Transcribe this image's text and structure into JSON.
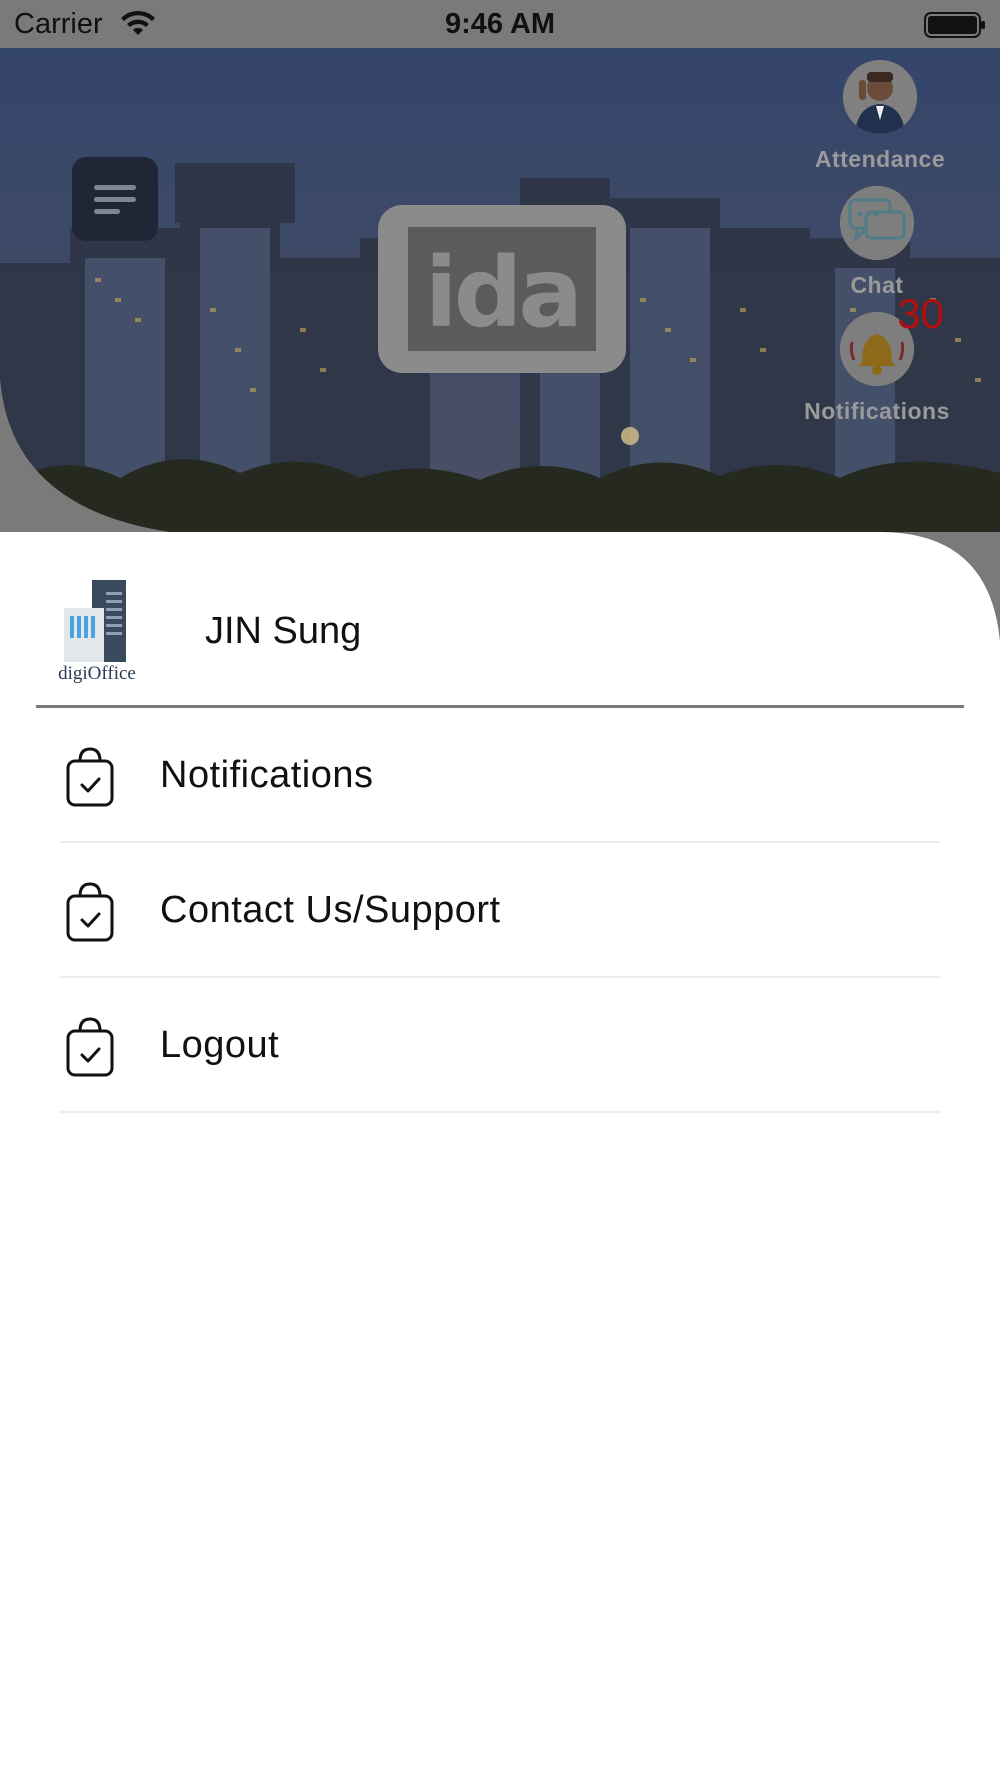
{
  "status_bar": {
    "carrier": "Carrier",
    "time": "9:46 AM"
  },
  "hero": {
    "logo_text": "ida",
    "quick_actions": [
      {
        "label": "Attendance",
        "icon": "attendance-avatar-icon"
      },
      {
        "label": "Chat",
        "icon": "chat-bubbles-icon"
      },
      {
        "label": "Notifications",
        "icon": "bell-icon",
        "badge": "30"
      }
    ]
  },
  "drawer": {
    "company_logo_text": "digiOffice",
    "user_name": "JIN Sung",
    "menu": [
      {
        "label": "Notifications",
        "icon": "shopping-bag-check-icon"
      },
      {
        "label": "Contact Us/Support",
        "icon": "shopping-bag-check-icon"
      },
      {
        "label": "Logout",
        "icon": "shopping-bag-check-icon"
      }
    ]
  },
  "colors": {
    "overlay_gray": "#7a7a7a",
    "badge_red": "#b01010",
    "drawer_bg": "#ffffff",
    "text": "#111111"
  }
}
